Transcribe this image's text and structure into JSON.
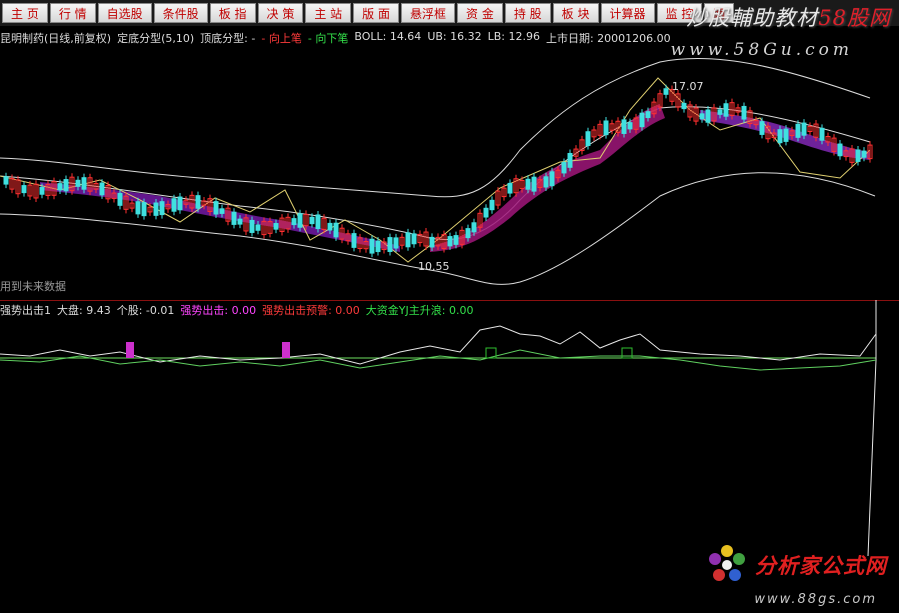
{
  "menu": [
    "主 页",
    "行 情",
    "自选股",
    "条件股",
    "板 指",
    "决 策",
    "主 站",
    "版 面",
    "悬浮框",
    "资 金",
    "持 股",
    "板 块",
    "计算器",
    "监 控",
    "两"
  ],
  "watermark": {
    "left": "炒股輔助教材",
    "right": "58股网",
    "url": "www.58Gu.com"
  },
  "info": {
    "stock": "昆明制药(日线,前复权)",
    "indicator": "定底分型(5,10)",
    "top_label": "顶底分型:",
    "top_val": "-",
    "up_pen": "向上笔",
    "up_val": "-",
    "down_pen": "向下笔",
    "boll": "BOLL: 14.64",
    "ub": "UB: 16.32",
    "lb": "LB: 12.96",
    "list_date": "上市日期: 20001206.00"
  },
  "future_note": "用到未来数据",
  "indicator_line": {
    "name": "强势出击1",
    "dapan": "大盘: 9.43",
    "gegu": "个股: -0.01",
    "strong": "强势出击: 0.00",
    "warn": "强势出击预警: 0.00",
    "funds": "大资金YJ主升浪: 0.00"
  },
  "price_labels": {
    "high": "17.07",
    "low": "10.55"
  },
  "bottom_logo": {
    "text": "分析家公式网",
    "url": "www.88gs.com"
  },
  "chart_data": {
    "type": "candlestick",
    "high_marker": 17.07,
    "low_marker": 10.55,
    "boll": {
      "mid": 14.64,
      "ub": 16.32,
      "lb": 12.96
    }
  }
}
